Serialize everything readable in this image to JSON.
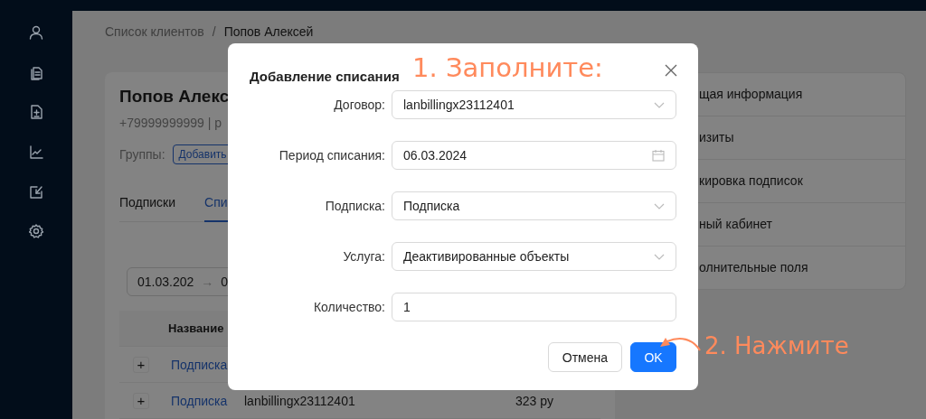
{
  "breadcrumb": {
    "items": [
      "Список клиентов",
      "Попов Алексей"
    ],
    "separator": "/"
  },
  "client": {
    "name": "Попов Алекс",
    "contacts": "+79999999999 | р",
    "groups_label": "Группы:",
    "add_group_button": "Добавить"
  },
  "tabs": [
    {
      "label": "Подписки",
      "selected": false
    },
    {
      "label": "Спи",
      "selected": true
    }
  ],
  "date_range": {
    "start": "01.03.202",
    "arrow": "→",
    "end": "0"
  },
  "table": {
    "columns": [
      "",
      "Название"
    ],
    "rows": [
      {
        "cells": [
          "+",
          "Подписка"
        ]
      },
      {
        "cells": [
          "+",
          "Подписка",
          "lanbillingx23112401",
          "323 ру"
        ]
      }
    ]
  },
  "side_menu": {
    "items": [
      "щая информация",
      "изиты",
      "кировка подписок",
      "ный кабинет",
      "олнительные поля"
    ]
  },
  "dialog": {
    "title": "Добавление списания",
    "fields": [
      {
        "label": "Договор:",
        "value": "lanbillingx23112401",
        "kind": "select"
      },
      {
        "label": "Период списания:",
        "value": "06.03.2024",
        "kind": "date"
      },
      {
        "label": "Подписка:",
        "value": "Подписка",
        "kind": "select"
      },
      {
        "label": "Услуга:",
        "value": "Деактивированные объекты",
        "kind": "select"
      },
      {
        "label": "Количество:",
        "value": "1",
        "kind": "input"
      }
    ],
    "buttons": [
      {
        "label": "Отмена",
        "primary": false
      },
      {
        "label": "OK",
        "primary": true
      }
    ]
  },
  "annotations": [
    {
      "text": "1. Заполните:"
    },
    {
      "text": "2. Нажмите"
    }
  ]
}
